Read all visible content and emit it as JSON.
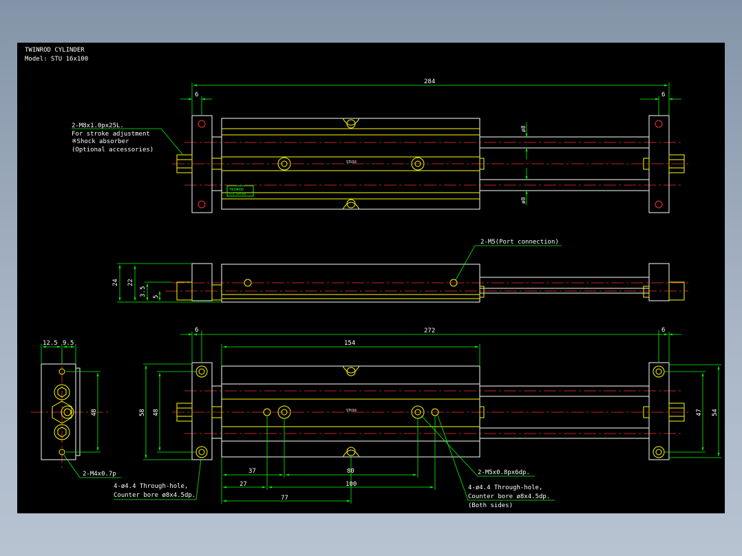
{
  "drawing": {
    "title": "TWINROD CYLINDER",
    "model": "Model: STU 16x100",
    "colors": {
      "background": "#000000",
      "outline": "#ffffff",
      "part": "#ffff00",
      "dimension": "#00ff00",
      "center": "#ff0000",
      "text": "#ffffff"
    }
  },
  "top_view": {
    "dims": {
      "overall": "284",
      "left_plate": "6",
      "right_plate": "6",
      "rod_top": "ø8",
      "rod_bottom": "ø8"
    },
    "body_label": "STU16",
    "nameplate": [
      "TWINROD",
      "STU 16x100"
    ],
    "callout": [
      "2-M8x1.0px25L.",
      "For stroke adjustment",
      "※Shock absorber",
      " (Optional accessories)"
    ]
  },
  "side_view": {
    "dims": {
      "height_24": "24",
      "height_22": "22",
      "d_3_5": "3.5",
      "d_5": "5"
    },
    "port_callout": "2-M5(Port connection)"
  },
  "bottom_view": {
    "dims": {
      "overall": "272",
      "left_plate": "6",
      "right_plate": "6",
      "span_154": "154",
      "h_58": "58",
      "h_48": "48",
      "h_47": "47",
      "h_54": "54",
      "d_37": "37",
      "d_80": "80",
      "d_27": "27",
      "d_100": "100",
      "d_77": "77"
    },
    "body_label": "STU16",
    "callout_left": [
      "4-ø4.4 Through-hole,",
      "Counter bore ø8x4.5dp."
    ],
    "callout_right_a": "2-M5x0.8px6dp.",
    "callout_right_b": [
      "4-ø4.4 Through-hole,",
      "Counter bore ø8x4.5dp.",
      "(Both sides)"
    ]
  },
  "end_view": {
    "dims": {
      "w_12_5": "12.5",
      "w_9_5": "9.5",
      "h_48": "48"
    },
    "callout": "2-M4x0.7p"
  }
}
